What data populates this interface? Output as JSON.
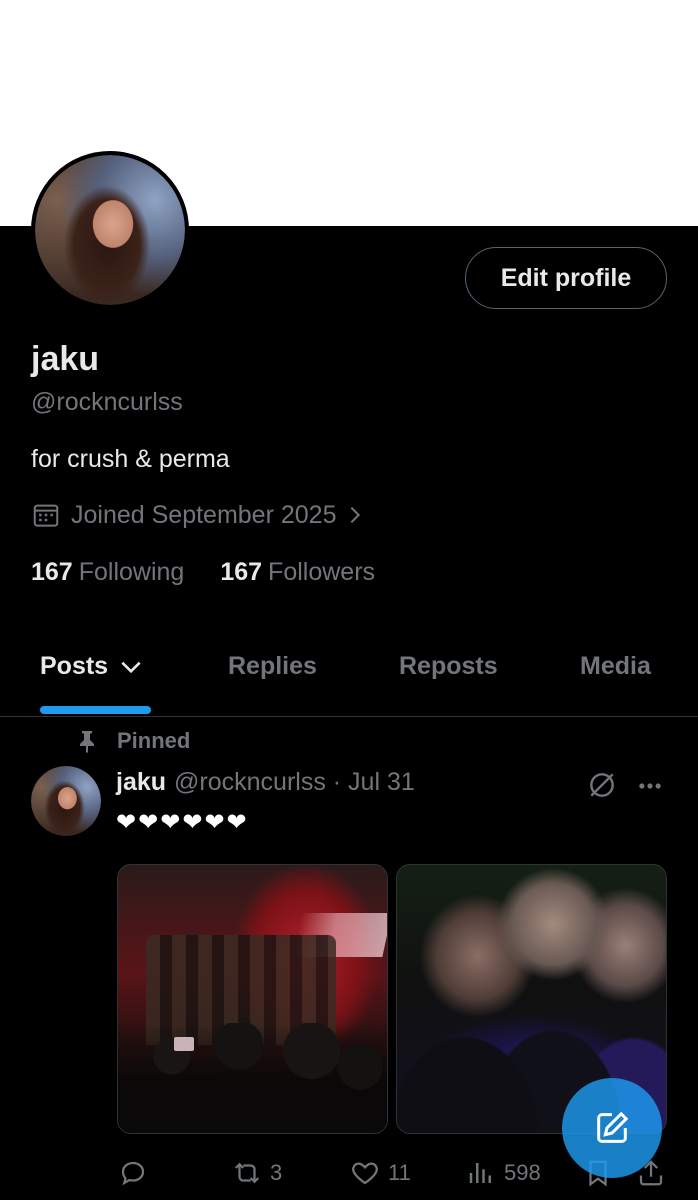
{
  "profile": {
    "display_name": "jaku",
    "handle": "@rockncurlss",
    "bio": "for crush & perma",
    "joined": "Joined September 2025",
    "following_count": "167",
    "following_label": "Following",
    "followers_count": "167",
    "followers_label": "Followers",
    "edit_button": "Edit profile",
    "banner_color": "#ffffff"
  },
  "tabs": [
    {
      "label": "Posts",
      "active": true
    },
    {
      "label": "Replies",
      "active": false
    },
    {
      "label": "Reposts",
      "active": false
    },
    {
      "label": "Media",
      "active": false
    }
  ],
  "post": {
    "pinned_label": "Pinned",
    "author_name": "jaku",
    "author_meta": "@rockncurlss · Jul 31",
    "text": "❤❤❤❤❤❤",
    "media": [
      "stage-concert-photo",
      "group-selfie-photo"
    ],
    "actions": {
      "replies": "",
      "reposts": "3",
      "likes": "11",
      "views": "598"
    }
  },
  "icons": {
    "calendar": "calendar-icon",
    "chevron": "chevron-right-icon",
    "pin": "pin-icon",
    "grok": "grok-icon",
    "more": "more-icon",
    "reply": "reply-icon",
    "repost": "repost-icon",
    "like": "heart-icon",
    "views": "views-icon",
    "bookmark": "bookmark-icon",
    "share": "share-icon",
    "compose": "compose-icon"
  },
  "colors": {
    "background": "#000000",
    "primary_text": "#e7e9ea",
    "secondary_text": "#71767b",
    "accent": "#1d9bf0",
    "border": "#2f3336"
  }
}
